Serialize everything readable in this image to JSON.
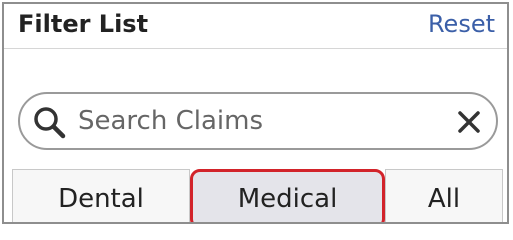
{
  "header": {
    "title": "Filter List",
    "reset_label": "Reset"
  },
  "search": {
    "placeholder": "Search Claims",
    "value": "",
    "icon": "search-icon",
    "clear_icon": "close-icon"
  },
  "tabs": [
    {
      "label": "Dental",
      "selected": false
    },
    {
      "label": "Medical",
      "selected": true
    },
    {
      "label": "All",
      "selected": false
    }
  ],
  "colors": {
    "link": "#3b5fa8",
    "highlight": "#d2232a",
    "selected_tab_bg": "#e4e4ea"
  }
}
